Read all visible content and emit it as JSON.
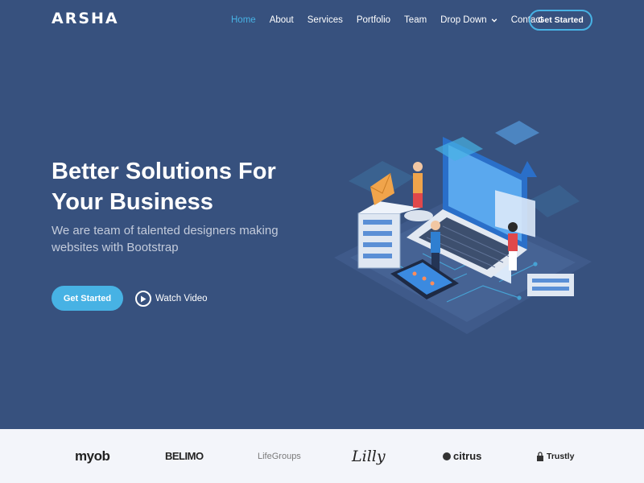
{
  "header": {
    "logo": "ARSHA",
    "nav": [
      "Home",
      "About",
      "Services",
      "Portfolio",
      "Team",
      "Drop Down",
      "Contact"
    ],
    "active_nav": "Home",
    "cta": "Get Started"
  },
  "hero": {
    "title": "Better Solutions For Your Business",
    "subtitle": "We are team of talented designers making websites with Bootstrap",
    "primary_button": "Get Started",
    "video_label": "Watch Video"
  },
  "clients": [
    "myob",
    "BELIMO",
    "LifeGroups",
    "Lilly",
    "citrus",
    "Trustly"
  ],
  "icons": [
    "chevron-down-icon",
    "play-icon",
    "lock-icon"
  ],
  "colors": {
    "hero_bg": "#37517e",
    "accent": "#47b2e4",
    "clients_bg": "#f3f5fa"
  }
}
